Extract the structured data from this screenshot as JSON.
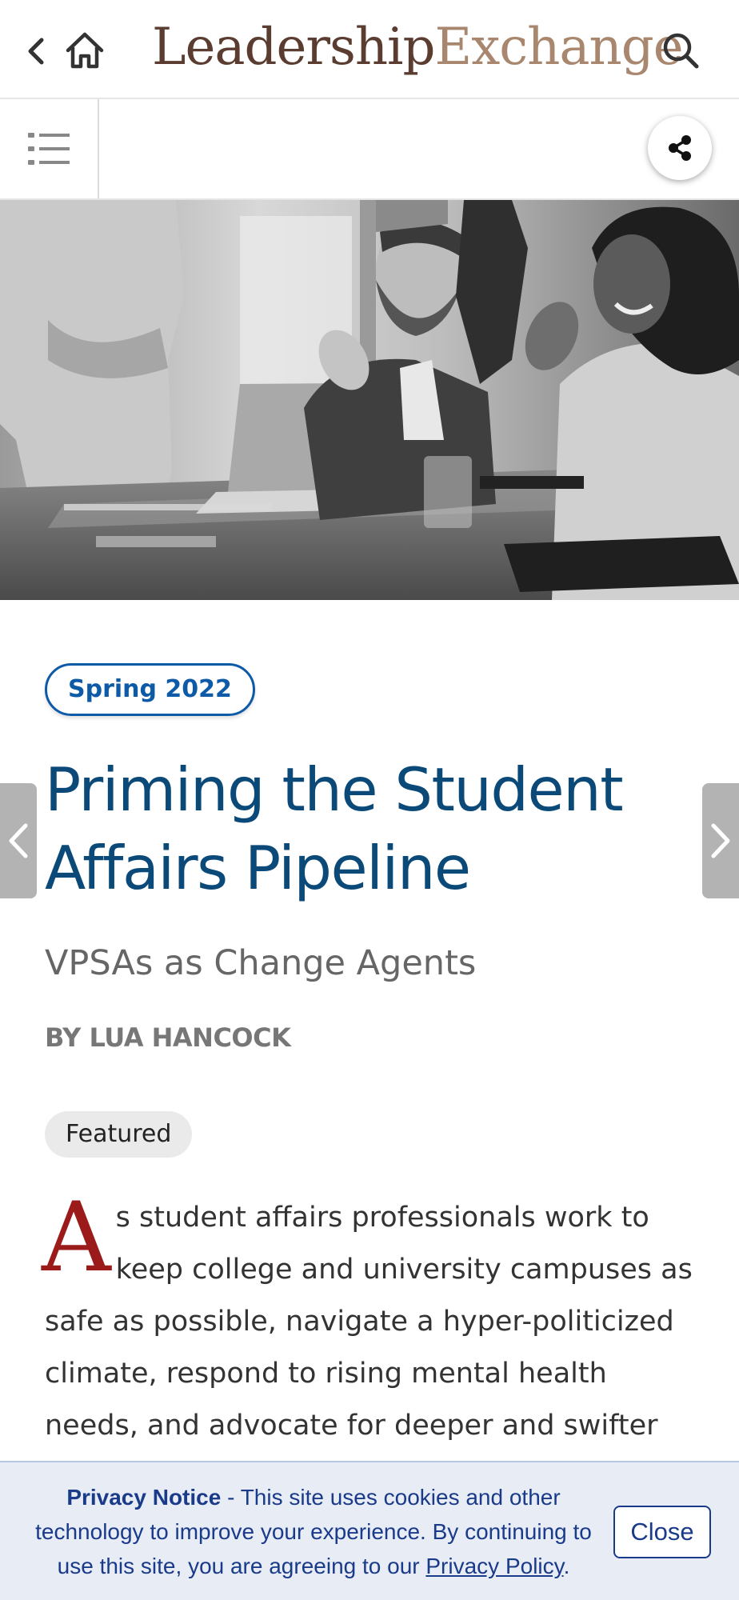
{
  "header": {
    "logo_part1": "Leadership",
    "logo_part2": "Exchange",
    "icons": [
      "back-icon",
      "home-icon",
      "search-icon"
    ]
  },
  "toolbar": {
    "icons": [
      "list-menu-icon",
      "share-icon"
    ]
  },
  "article": {
    "issue": "Spring 2022",
    "title": "Priming the Student Affairs Pipeline",
    "subtitle": "VPSAs as Change Agents",
    "byline": "BY LUA HANCOCK",
    "tag": "Featured",
    "drop_cap": "A",
    "body_rest": "s student affairs professionals work to keep college and university campuses as safe as possible, navigate a hyper-politicized climate, respond to rising mental health needs, and advocate for deeper and swifter responses"
  },
  "privacy": {
    "heading": "Privacy Notice",
    "text": " - This site uses cookies and other technology to improve your experience. By continuing to use this site, you are agreeing to our ",
    "link_label": "Privacy Policy",
    "end": ".",
    "close_label": "Close"
  },
  "colors": {
    "title": "#0b4a78",
    "badge": "#0d5aa7",
    "drop_cap": "#9b1b1b",
    "privacy_bg": "#e7ecf5",
    "privacy_text": "#1a3a8a"
  }
}
